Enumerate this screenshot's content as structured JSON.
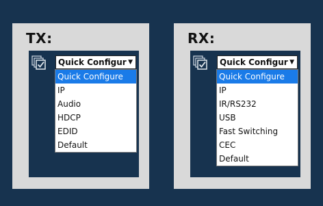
{
  "tx": {
    "title": "TX:",
    "select_value": "Quick Configure",
    "options": [
      "Quick Configure",
      "IP",
      "Audio",
      "HDCP",
      "EDID",
      "Default"
    ]
  },
  "rx": {
    "title": "RX:",
    "select_value": "Quick Configure",
    "options": [
      "Quick Configure",
      "IP",
      "IR/RS232",
      "USB",
      "Fast Switching",
      "CEC",
      "Default"
    ]
  },
  "icons": {
    "dropdown_arrow": "▼",
    "config_icon": "checklist-icon"
  },
  "colors": {
    "background": "#17334f",
    "panel": "#d9d9d9",
    "highlight": "#1a7be8"
  }
}
